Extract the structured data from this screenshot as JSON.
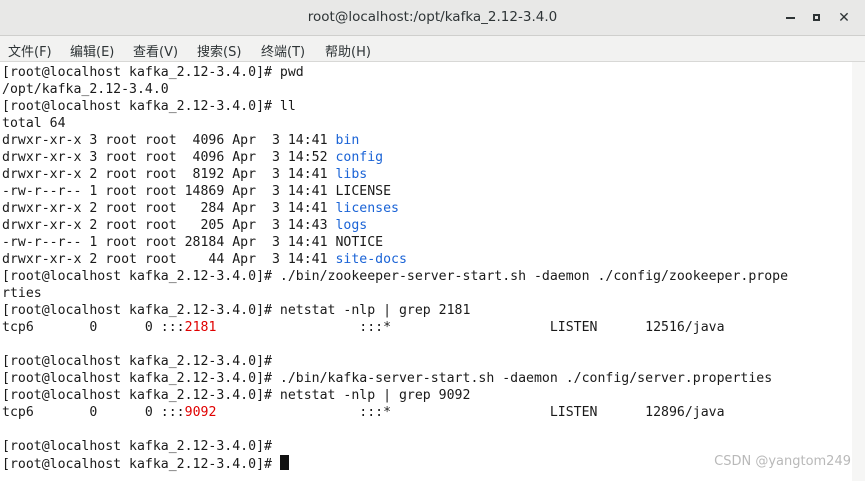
{
  "window": {
    "title": "root@localhost:/opt/kafka_2.12-3.4.0",
    "close_glyph": "✕"
  },
  "menu": {
    "items": [
      "文件(F)",
      "编辑(E)",
      "查看(V)",
      "搜索(S)",
      "终端(T)",
      "帮助(H)"
    ]
  },
  "terminal": {
    "prompt": "[root@localhost kafka_2.12-3.4.0]# ",
    "cmd_pwd": "pwd",
    "out_pwd": "/opt/kafka_2.12-3.4.0",
    "cmd_ll": "ll",
    "out_total": "total 64",
    "listing": [
      {
        "meta": "drwxr-xr-x 3 root root  4096 Apr  3 14:41 ",
        "name": "bin",
        "dir": true
      },
      {
        "meta": "drwxr-xr-x 3 root root  4096 Apr  3 14:52 ",
        "name": "config",
        "dir": true
      },
      {
        "meta": "drwxr-xr-x 2 root root  8192 Apr  3 14:41 ",
        "name": "libs",
        "dir": true
      },
      {
        "meta": "-rw-r--r-- 1 root root 14869 Apr  3 14:41 ",
        "name": "LICENSE",
        "dir": false
      },
      {
        "meta": "drwxr-xr-x 2 root root   284 Apr  3 14:41 ",
        "name": "licenses",
        "dir": true
      },
      {
        "meta": "drwxr-xr-x 2 root root   205 Apr  3 14:43 ",
        "name": "logs",
        "dir": true
      },
      {
        "meta": "-rw-r--r-- 1 root root 28184 Apr  3 14:41 ",
        "name": "NOTICE",
        "dir": false
      },
      {
        "meta": "drwxr-xr-x 2 root root    44 Apr  3 14:41 ",
        "name": "site-docs",
        "dir": true
      }
    ],
    "cmd_zk_start": "./bin/zookeeper-server-start.sh -daemon ./config/zookeeper.prope",
    "cmd_zk_start_wrap": "rties",
    "cmd_netstat_2181": "netstat -nlp | grep 2181",
    "ns1": {
      "pre": "tcp6       0      0 :::",
      "port": "2181",
      "post": "                  :::*                    LISTEN      12516/java"
    },
    "cmd_kafka_start": "./bin/kafka-server-start.sh -daemon ./config/server.properties",
    "cmd_netstat_9092": "netstat -nlp | grep 9092",
    "ns2": {
      "pre": "tcp6       0      0 :::",
      "port": "9092",
      "post": "                  :::*                    LISTEN      12896/java"
    }
  },
  "watermark": "CSDN @yangtom249",
  "colors": {
    "dir": "#1a63d6",
    "port": "#e00000"
  }
}
